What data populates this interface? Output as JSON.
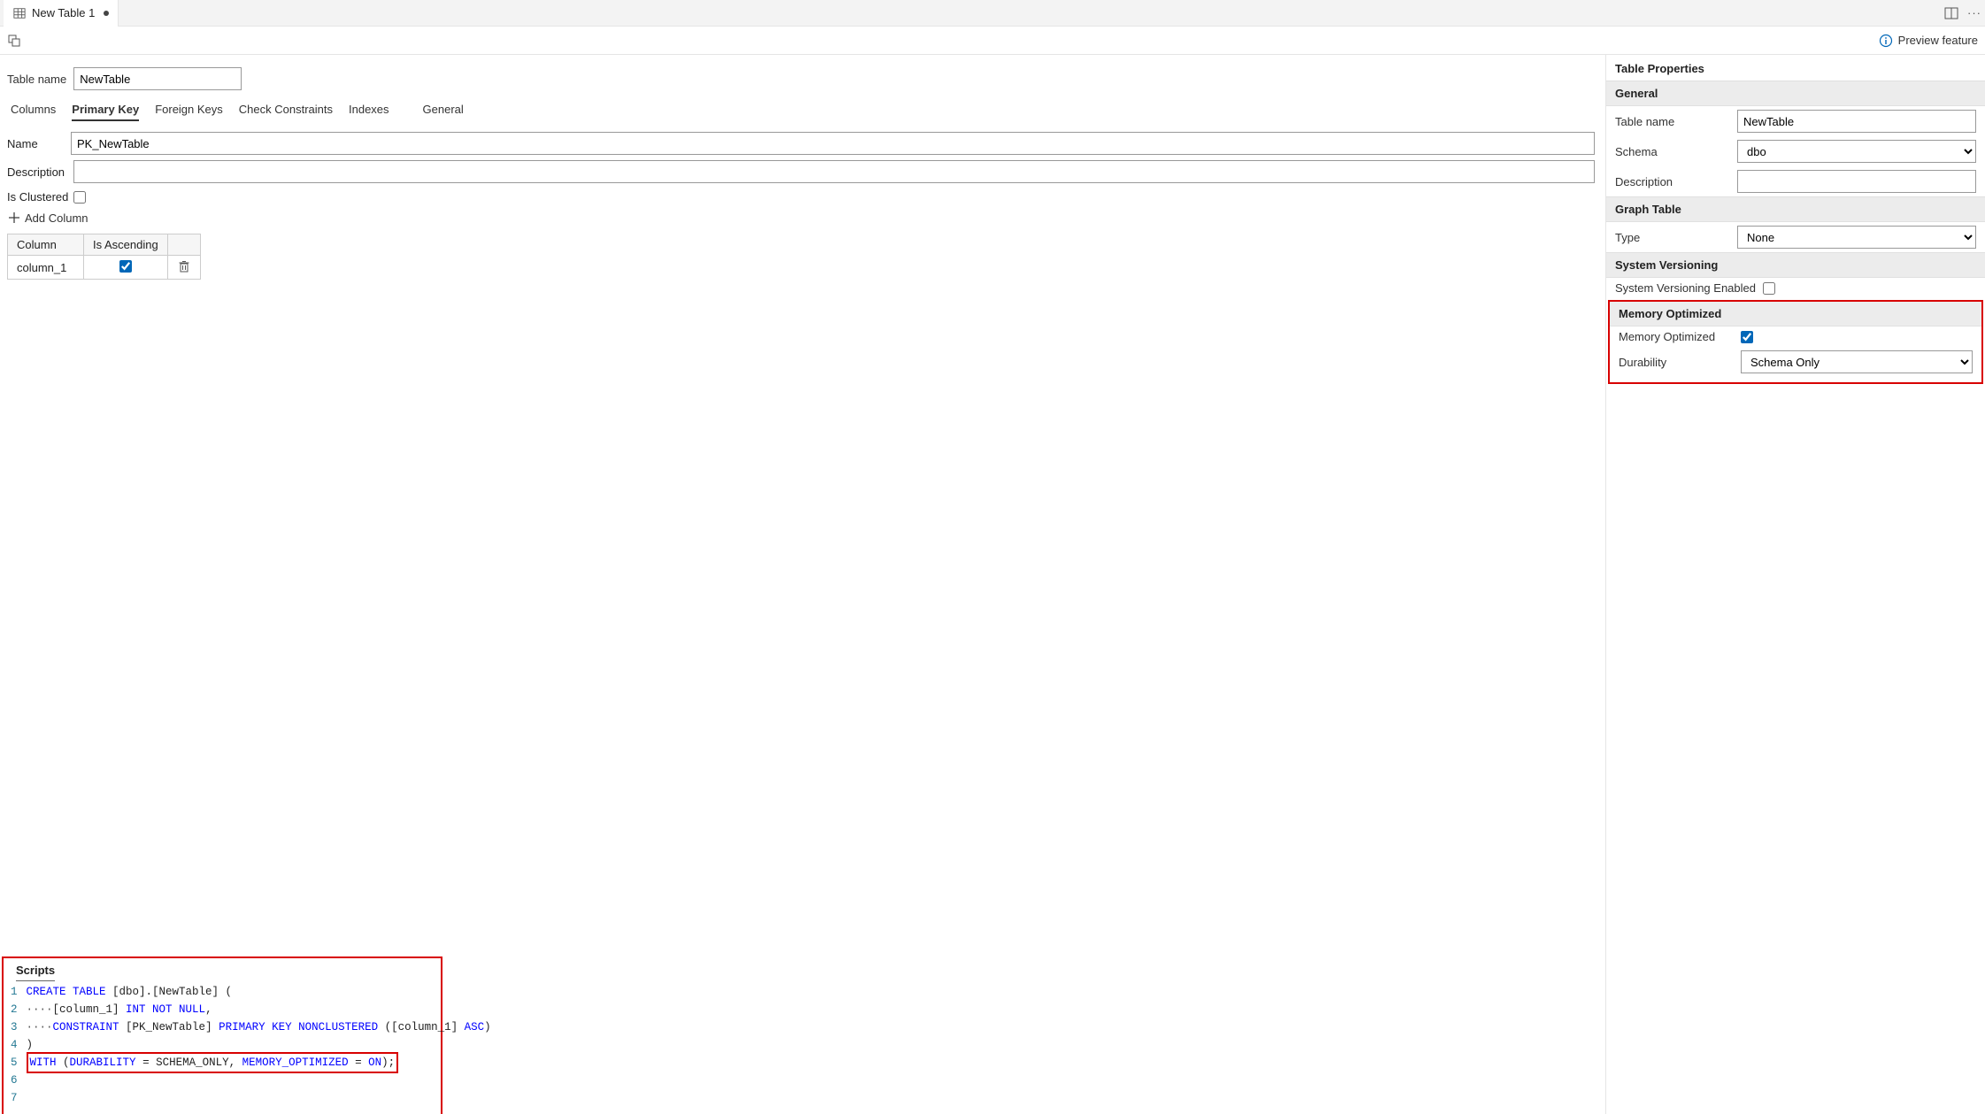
{
  "tab": {
    "title": "New Table 1",
    "dirty": true
  },
  "header_right": {
    "preview": "Preview feature"
  },
  "table_name_label": "Table name",
  "table_name": "NewTable",
  "designer_tabs": [
    "Columns",
    "Primary Key",
    "Foreign Keys",
    "Check Constraints",
    "Indexes",
    "General"
  ],
  "designer_active": 1,
  "pk": {
    "name_label": "Name",
    "name": "PK_NewTable",
    "desc_label": "Description",
    "desc": "",
    "isclustered_label": "Is Clustered",
    "isclustered": false,
    "add_column": "Add Column",
    "grid_headers": {
      "column": "Column",
      "asc": "Is Ascending"
    },
    "rows": [
      {
        "column": "column_1",
        "asc": true
      }
    ]
  },
  "props": {
    "title": "Table Properties",
    "sections": {
      "general": "General",
      "graph": "Graph Table",
      "sysver": "System Versioning",
      "memopt": "Memory Optimized"
    },
    "labels": {
      "tablename": "Table name",
      "schema": "Schema",
      "description": "Description",
      "type": "Type",
      "sysver_enabled": "System Versioning Enabled",
      "memopt": "Memory Optimized",
      "durability": "Durability"
    },
    "values": {
      "tablename": "NewTable",
      "schema": "dbo",
      "description": "",
      "type": "None",
      "sysver_enabled": false,
      "memopt": true,
      "durability": "Schema Only"
    }
  },
  "scripts": {
    "label": "Scripts",
    "line1": {
      "a": "CREATE TABLE",
      "b": " [dbo].[NewTable] ("
    },
    "line2": {
      "dots": "····",
      "a": "[column_1] ",
      "b": "INT NOT NULL",
      "c": ","
    },
    "line3": {
      "dots": "····",
      "a": "CONSTRAINT",
      "b": " [PK_NewTable] ",
      "c": "PRIMARY KEY NONCLUSTERED",
      "d": " ([column_1] ",
      "e": "ASC",
      "f": ")"
    },
    "line4": ")",
    "line5": {
      "a": "WITH",
      "b": " (",
      "c": "DURABILITY",
      "d": " = SCHEMA_ONLY, ",
      "e": "MEMORY_OPTIMIZED",
      "f": " = ",
      "g": "ON",
      "h": ");"
    }
  }
}
